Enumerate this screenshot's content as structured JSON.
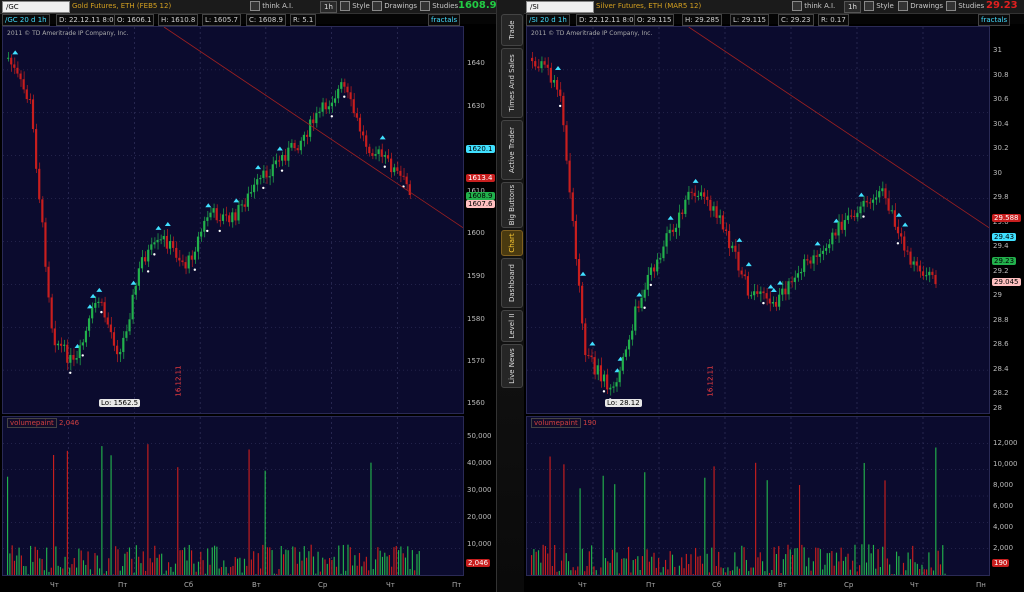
{
  "tabs": [
    "Trade",
    "Times And Sales",
    "Active Trader",
    "Big Buttons",
    "Chart",
    "Dashboard",
    "Level II",
    "Live News"
  ],
  "active_tab": "Chart",
  "left": {
    "symbol": "/GC",
    "description": "Gold Futures, ETH (FEB5 12)",
    "think_label": "think A.I.",
    "timeframe": "1h",
    "style_label": "Style",
    "drawings_label": "Drawings",
    "studies_label": "Studies",
    "last_price": "1608.90",
    "change": "1%",
    "info": {
      "period": "/GC 20 d 1h",
      "date": "D: 22.12.11 8:00",
      "open": "O: 1606.1",
      "high": "H: 1610.8",
      "low": "L: 1605.7",
      "close": "C: 1608.9",
      "range": "R: 5.1",
      "fractals": "fractals"
    },
    "copyright": "2011 © TD Ameritrade IP Company, Inc.",
    "yaxis": [
      "1640",
      "1630",
      "1620",
      "1610",
      "1600",
      "1590",
      "1580",
      "1570",
      "1560"
    ],
    "tags": {
      "cyan": "1620.1",
      "red": "1613.4",
      "green": "1608.9",
      "pink": "1607.6"
    },
    "lo_label": "Lo: 1562.5",
    "date_marker": "16.12.11",
    "volume_name": "volumepaint",
    "volume_value": "2,046",
    "vol_yaxis": [
      "50,000",
      "40,000",
      "30,000",
      "20,000",
      "10,000"
    ],
    "vol_tag": "2,046",
    "xaxis": [
      "Чт",
      "Пт",
      "Сб",
      "Вт",
      "Ср",
      "Чт",
      "Пт"
    ]
  },
  "right": {
    "symbol": "/SI",
    "description": "Silver Futures, ETH (MAR5 12)",
    "think_label": "think A.I.",
    "timeframe": "1h",
    "style_label": "Style",
    "drawings_label": "Drawings",
    "studies_label": "Studies",
    "last_price": "29.23",
    "info": {
      "period": "/SI 20 d 1h",
      "date": "D: 22.12.11 8:00",
      "open": "O: 29.115",
      "high": "H: 29.285",
      "low": "L: 29.115",
      "close": "C: 29.23",
      "range": "R: 0.17",
      "fractals": "fractals"
    },
    "copyright": "2011 © TD Ameritrade IP Company, Inc.",
    "yaxis": [
      "31",
      "30.8",
      "30.6",
      "30.4",
      "30.2",
      "30",
      "29.8",
      "29.6",
      "29.4",
      "29.2",
      "29",
      "28.8",
      "28.6",
      "28.4",
      "28.2",
      "28"
    ],
    "tags": {
      "red": "29.588",
      "cyan": "29.43",
      "green": "29.23",
      "pink": "29.045"
    },
    "lo_label": "Lo: 28.12",
    "date_marker": "16.12.11",
    "volume_name": "volumepaint",
    "volume_value": "190",
    "vol_yaxis": [
      "12,000",
      "10,000",
      "8,000",
      "6,000",
      "4,000",
      "2,000"
    ],
    "vol_tag": "190",
    "xaxis": [
      "Чт",
      "Пт",
      "Сб",
      "Вт",
      "Ср",
      "Чт",
      "Пн"
    ]
  },
  "colors": {
    "plot_bg": "#0b0b2e",
    "up": "#22b14c",
    "down": "#c81e1e",
    "fractal": "#40e0ff",
    "grid": "#3a3a66"
  }
}
